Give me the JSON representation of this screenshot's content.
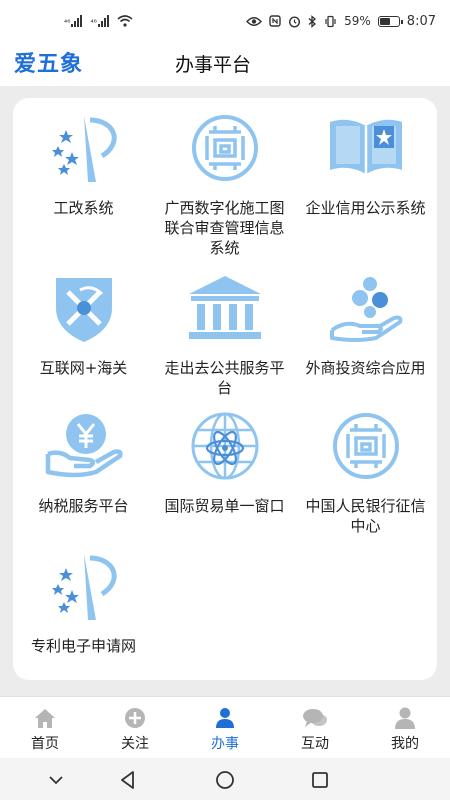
{
  "status": {
    "signal_1": "⁴⁶",
    "signal_2": "⁴⁶",
    "battery": "59%",
    "battery_level": 0.59,
    "time": "8:07"
  },
  "header": {
    "logo": "爱五象",
    "title": "办事平台"
  },
  "services": [
    {
      "label": "工改系统",
      "icon": "arrow-stars-icon"
    },
    {
      "label": "广西数字化施工图联合审查管理信息系统",
      "icon": "maze-emblem-icon"
    },
    {
      "label": "企业信用公示系统",
      "icon": "open-book-star-icon"
    },
    {
      "label": "互联网+海关",
      "icon": "customs-shield-icon"
    },
    {
      "label": "走出去公共服务平台",
      "icon": "bank-building-icon"
    },
    {
      "label": "外商投资综合应用",
      "icon": "hand-coins-icon"
    },
    {
      "label": "纳税服务平台",
      "icon": "hand-yen-icon"
    },
    {
      "label": "国际贸易单一窗口",
      "icon": "globe-atom-icon"
    },
    {
      "label": "中国人民银行征信中心",
      "icon": "maze-emblem-icon"
    },
    {
      "label": "专利电子申请网",
      "icon": "arrow-stars-icon"
    }
  ],
  "tabs": [
    {
      "label": "首页",
      "icon": "home-icon",
      "active": false
    },
    {
      "label": "关注",
      "icon": "plus-circle-icon",
      "active": false
    },
    {
      "label": "办事",
      "icon": "person-icon",
      "active": true
    },
    {
      "label": "互动",
      "icon": "chat-icon",
      "active": false
    },
    {
      "label": "我的",
      "icon": "user-icon",
      "active": false
    }
  ],
  "colors": {
    "accent": "#1f6fd6",
    "icon_blue": "#8ec4ef",
    "icon_dark": "#4a8fd8"
  }
}
